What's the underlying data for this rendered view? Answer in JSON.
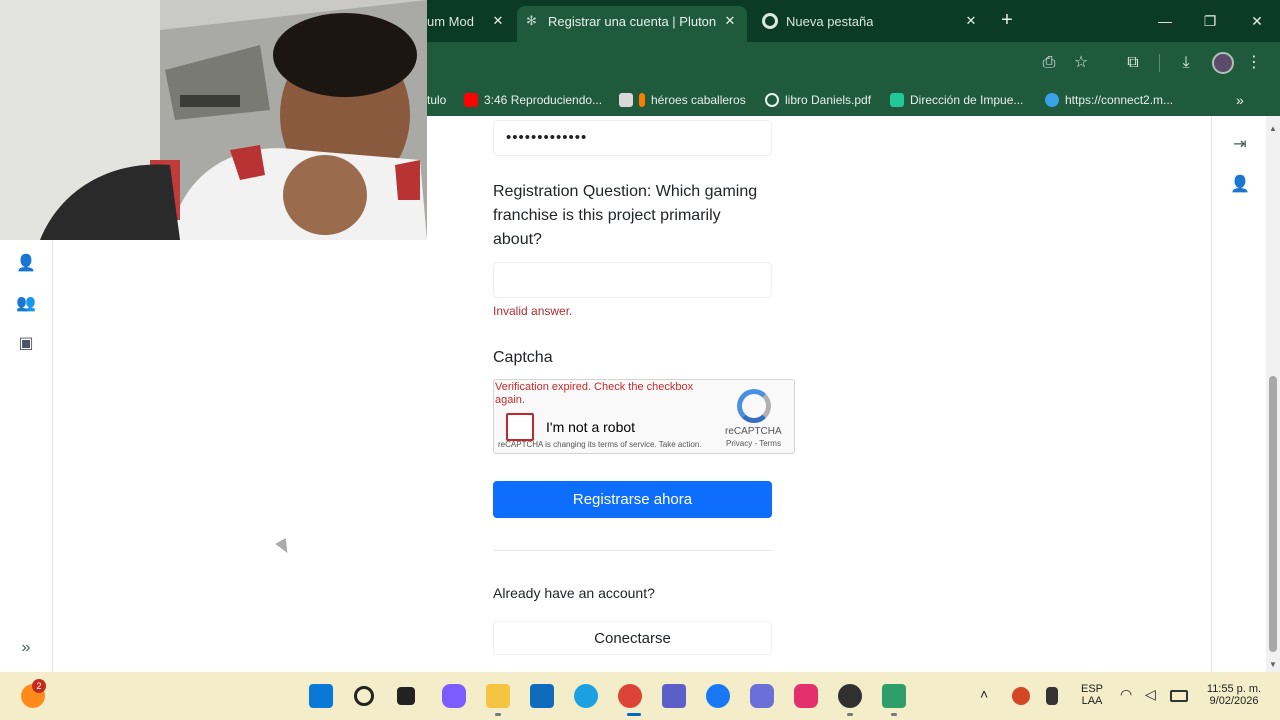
{
  "browser": {
    "tabs": [
      {
        "title": "um Mod"
      },
      {
        "title": "Registrar una cuenta | Plutonium",
        "active": true
      },
      {
        "title": "Nueva pestaña"
      }
    ],
    "bookmarks": [
      {
        "label": "tulo"
      },
      {
        "label": "3:46 Reproduciendo..."
      },
      {
        "label": "héroes caballeros"
      },
      {
        "label": "libro Daniels.pdf"
      },
      {
        "label": "Dirección de Impue..."
      },
      {
        "label": "https://connect2.m..."
      }
    ]
  },
  "form": {
    "password_mask": "•••••••••••••",
    "registration_question": "Registration Question: Which gaming franchise is this project primarily about?",
    "answer_value": "",
    "answer_error": "Invalid answer.",
    "captcha_label": "Captcha",
    "recaptcha": {
      "error": "Verification expired. Check the checkbox again.",
      "checkbox_label": "I'm not a robot",
      "brand": "reCAPTCHA",
      "links": "Privacy - Terms",
      "notice": "reCAPTCHA is changing its terms of service. Take action."
    },
    "submit_label": "Registrarse ahora",
    "already_text": "Already have an account?",
    "login_label": "Conectarse"
  },
  "taskbar": {
    "notification_count": "2",
    "language": "ESP",
    "language_sub": "LAA",
    "time": "11:55 p. m.",
    "date": "9/02/2026"
  },
  "colors": {
    "chrome_dark": "#0b3b25",
    "chrome": "#1f5a3d",
    "primary_button": "#0d6efd",
    "error": "#b32d2e",
    "taskbar": "#f3edc9"
  }
}
